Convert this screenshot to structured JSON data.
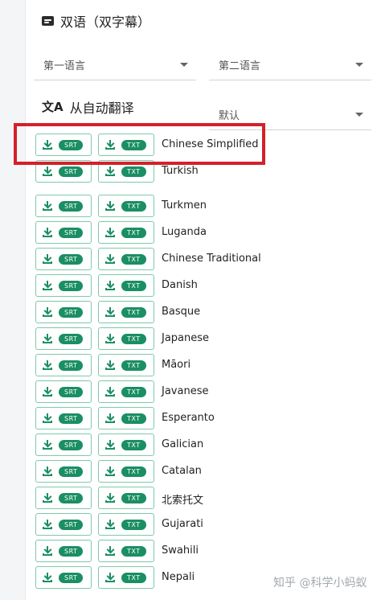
{
  "bilingual": {
    "title": "双语（双字幕）",
    "first_language": "第一语言",
    "second_language": "第二语言"
  },
  "auto_translate": {
    "title": "从自动翻译",
    "selected": "默认"
  },
  "buttons": {
    "srt": "SRT",
    "txt": "TXT"
  },
  "languages": [
    "Chinese Simplified",
    "Turkish",
    "Turkmen",
    "Luganda",
    "Chinese Traditional",
    "Danish",
    "Basque",
    "Japanese",
    "Māori",
    "Javanese",
    "Esperanto",
    "Galician",
    "Catalan",
    "北索托文",
    "Gujarati",
    "Swahili",
    "Nepali"
  ],
  "watermark": "知乎 @科学小蚂蚁",
  "colors": {
    "accent": "#1a8f63",
    "accent_border": "#7ec9a9",
    "highlight": "#d4202a"
  }
}
